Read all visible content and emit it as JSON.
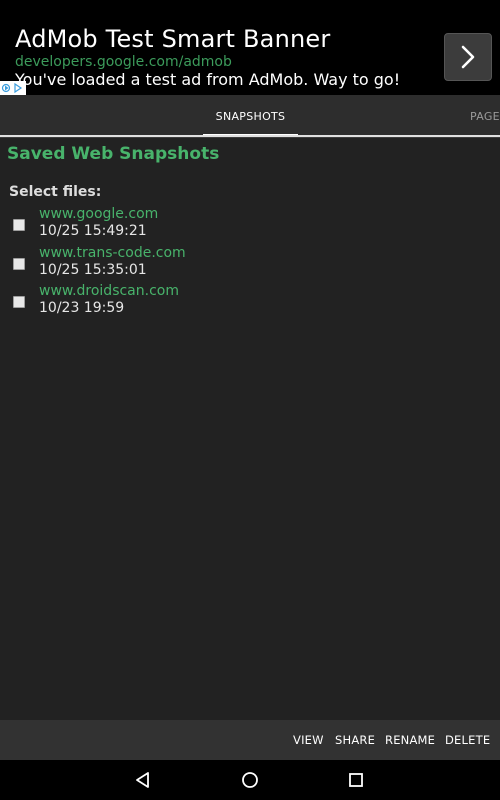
{
  "ad": {
    "title": "AdMob Test Smart Banner",
    "url": "developers.google.com/admob",
    "text": "You've loaded a test ad from AdMob. Way to go!",
    "next_icon": "chevron-right-icon",
    "choices_icon": "adchoices-icon"
  },
  "tabs": [
    {
      "label": "SNAPSHOTS",
      "selected": true
    },
    {
      "label": "PAGES",
      "selected": false
    }
  ],
  "main": {
    "title": "Saved Web Snapshots",
    "select_label": "Select files:",
    "files": [
      {
        "name": "www.google.com",
        "time": "10/25 15:49:21",
        "checked": false
      },
      {
        "name": "www.trans-code.com",
        "time": "10/25 15:35:01",
        "checked": false
      },
      {
        "name": "www.droidscan.com",
        "time": "10/23 19:59",
        "checked": false
      }
    ]
  },
  "actions": {
    "view": "VIEW",
    "share": "SHARE",
    "rename": "RENAME",
    "delete": "DELETE"
  },
  "navbar": {
    "back_icon": "back-triangle-icon",
    "home_icon": "home-circle-icon",
    "recents_icon": "recents-square-icon"
  },
  "colors": {
    "accent": "#48b36b",
    "background": "#222222",
    "ad_background": "#000000",
    "tab_bar": "#2d2d2d",
    "bottom_bar": "#323232"
  }
}
